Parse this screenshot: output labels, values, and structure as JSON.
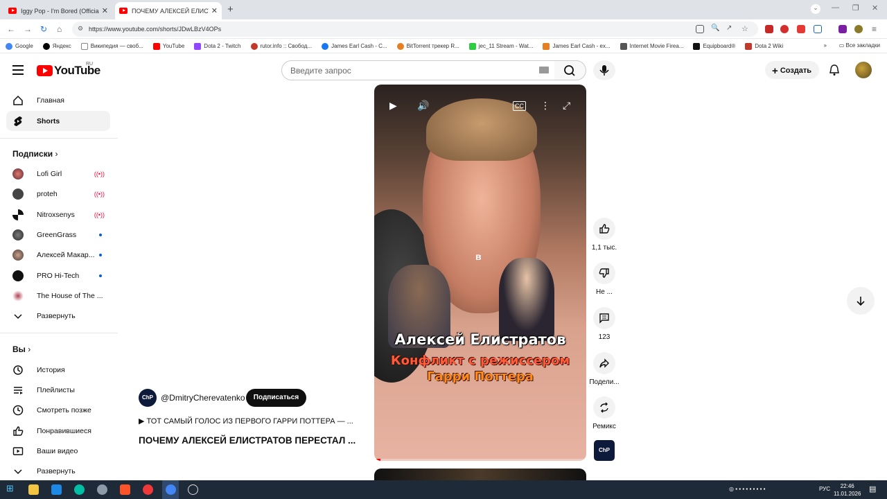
{
  "browser": {
    "tabs": [
      {
        "title": "Iggy Pop - I'm Bored (Official V",
        "active": false
      },
      {
        "title": "ПОЧЕМУ АЛЕКСЕЙ ЕЛИСТРАТ",
        "active": true
      }
    ],
    "url": "https://www.youtube.com/shorts/JDwLBzV4OPs",
    "bookmarks": [
      "Google",
      "Яндекс",
      "Википедия — своб...",
      "YouTube",
      "Dota 2 - Twitch",
      "rutor.info :: Свобод...",
      "James Earl Cash - C...",
      "BitTorrent трекер R...",
      "jec_11 Stream - Wat...",
      "James Earl Cash - ex...",
      "Internet Movie Firea...",
      "Equipboard®",
      "Dota 2 Wiki"
    ],
    "all_bookmarks": "Все закладки"
  },
  "header": {
    "logo": "YouTube",
    "country": "RU",
    "search_placeholder": "Введите запрос",
    "create_label": "Создать"
  },
  "sidebar": {
    "home": "Главная",
    "shorts": "Shorts",
    "subscriptions_title": "Подписки",
    "channels": [
      {
        "name": "Lofi Girl",
        "status": "live"
      },
      {
        "name": "proteh",
        "status": "live"
      },
      {
        "name": "Nitroxsenys",
        "status": "live"
      },
      {
        "name": "GreenGrass",
        "status": "new"
      },
      {
        "name": "Алексей Макар...",
        "status": "new"
      },
      {
        "name": "PRO Hi-Tech",
        "status": "new"
      },
      {
        "name": "The House of The ...",
        "status": "none"
      }
    ],
    "expand": "Развернуть",
    "you_title": "Вы",
    "you_items": [
      "История",
      "Плейлисты",
      "Смотреть позже",
      "Понравившиеся",
      "Ваши видео"
    ],
    "expand2": "Развернуть"
  },
  "video": {
    "subtitle": "в",
    "caption_name": "Алексей Елистратов",
    "caption_line2": "Конфликт с режиссером",
    "caption_line3": "Гарри Поттера",
    "channel_avatar": "ChP",
    "channel": "@DmitryCherevatenko",
    "subscribe": "Подписаться",
    "description": "▶ ТОТ САМЫЙ ГОЛОС ИЗ ПЕРВОГО ГАРРИ ПОТТЕРА — ...",
    "title": "ПОЧЕМУ АЛЕКСЕЙ ЕЛИСТРАТОВ ПЕРЕСТАЛ ...",
    "progress": 0.03
  },
  "actions": {
    "likes": "1,1 тыс.",
    "dislike": "Не ...",
    "comments": "123",
    "share": "Подели...",
    "remix": "Ремикс"
  },
  "taskbar": {
    "lang": "РУС",
    "time": "22:46",
    "date": "11.01.2026"
  }
}
